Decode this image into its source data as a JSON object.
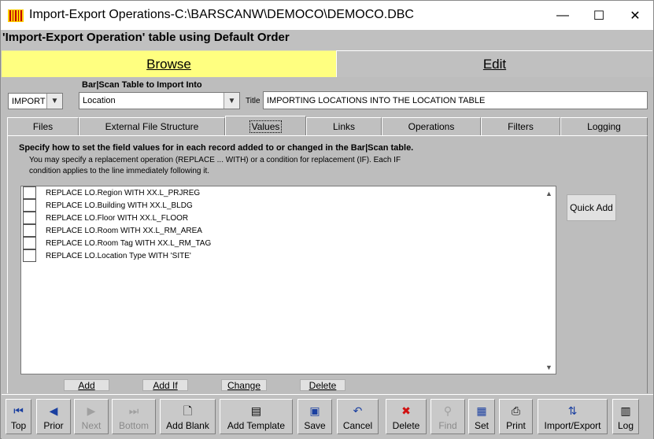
{
  "window": {
    "title": "Import-Export Operations-C:\\BARSCANW\\DEMOCO\\DEMOCO.DBC",
    "minimize_glyph": "—",
    "maximize_glyph": "☐",
    "close_glyph": "✕"
  },
  "header": {
    "subtitle": "'Import-Export Operation' table using Default Order"
  },
  "view_tabs": {
    "browse": "Browse",
    "edit": "Edit"
  },
  "form": {
    "operation_select": "IMPORT",
    "table_label": "Bar|Scan Table to Import Into",
    "table_select": "Location",
    "title_label": "Title",
    "title_value": "IMPORTING LOCATIONS INTO THE LOCATION TABLE"
  },
  "tabs": [
    "Files",
    "External File Structure",
    "Values",
    "Links",
    "Operations",
    "Filters",
    "Logging"
  ],
  "values_panel": {
    "heading": "Specify how to set the field values for in each record added to or changed in the Bar|Scan table.",
    "line1": "You may specify a replacement operation (REPLACE ... WITH) or a condition for replacement (IF). Each IF",
    "line2": "condition applies to the line immediately following it.",
    "rows": [
      "REPLACE LO.Region WITH XX.L_PRJREG",
      "REPLACE LO.Building WITH XX.L_BLDG",
      "REPLACE LO.Floor WITH XX.L_FLOOR",
      "REPLACE LO.Room WITH XX.L_RM_AREA",
      "REPLACE LO.Room Tag WITH XX.L_RM_TAG",
      "REPLACE LO.Location Type WITH 'SITE'"
    ],
    "quick_add": "Quick Add",
    "add": "Add",
    "add_if": "Add If",
    "change": "Change",
    "delete": "Delete"
  },
  "toolbar": {
    "top": "Top",
    "prior": "Prior",
    "next": "Next",
    "bottom": "Bottom",
    "add_blank": "Add Blank",
    "add_template": "Add Template",
    "save": "Save",
    "cancel": "Cancel",
    "delete": "Delete",
    "find": "Find",
    "set": "Set",
    "print": "Print",
    "import_export": "Import/Export",
    "log": "Log"
  }
}
